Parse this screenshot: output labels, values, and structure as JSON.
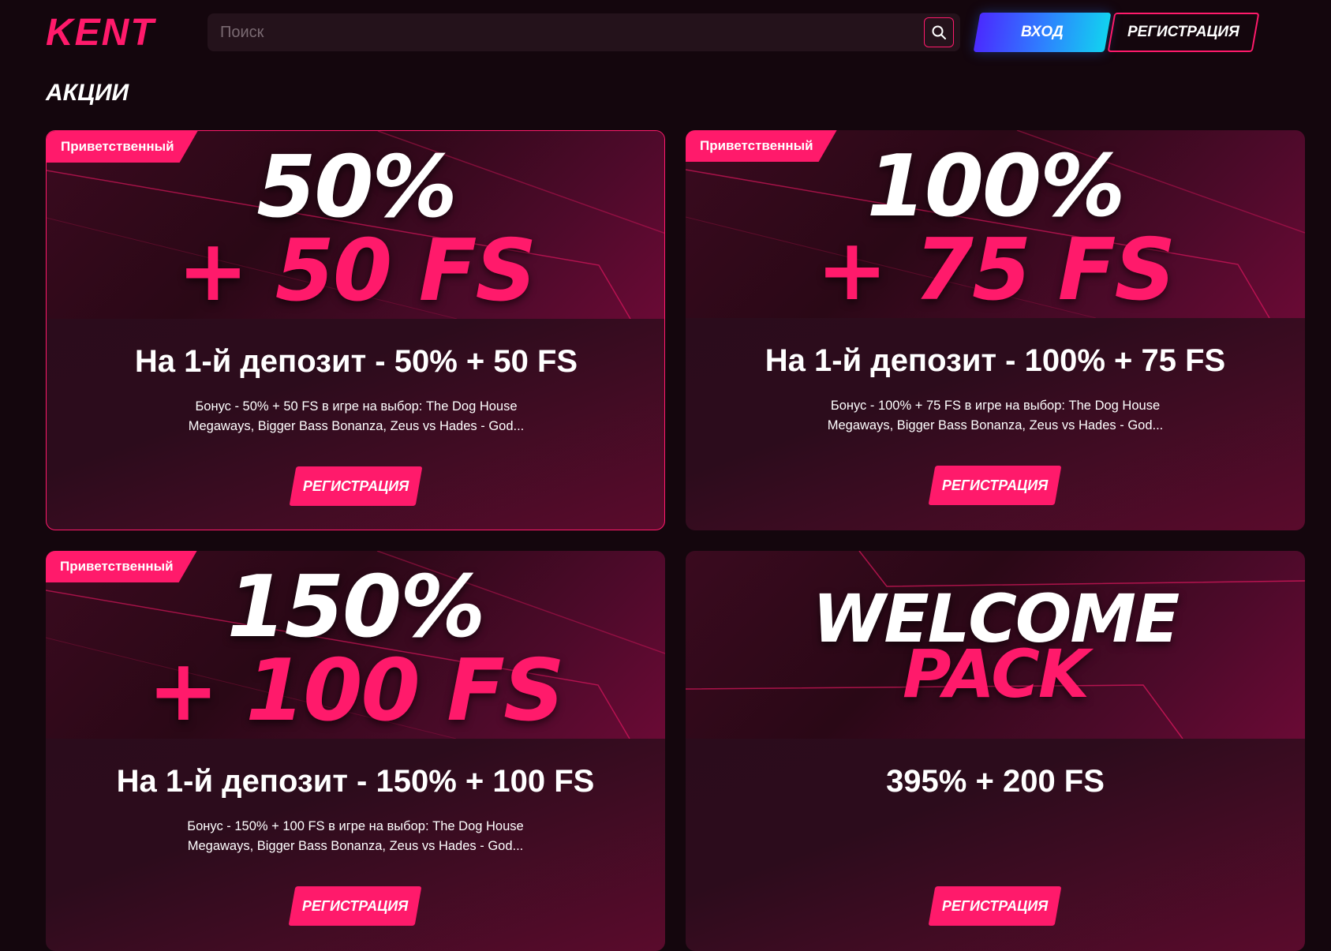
{
  "header": {
    "logo": "KENT",
    "search_placeholder": "Поиск",
    "login_label": "ВХОД",
    "register_label": "РЕГИСТРАЦИЯ"
  },
  "page": {
    "title": "АКЦИИ"
  },
  "cards": [
    {
      "tag": "Приветственный",
      "banner_line1": "50%",
      "banner_line2": "+ 50 FS",
      "title": "На 1-й депозит - 50% + 50 FS",
      "description": "Бонус - 50% + 50 FS в игре на выбор: The Dog House Megaways, Bigger Bass Bonanza, Zeus vs Hades - God...",
      "button": "РЕГИСТРАЦИЯ"
    },
    {
      "tag": "Приветственный",
      "banner_line1": "100%",
      "banner_line2": "+ 75 FS",
      "title": "На 1-й депозит - 100% + 75 FS",
      "description": "Бонус - 100% + 75 FS в игре на выбор: The Dog House Megaways, Bigger Bass Bonanza, Zeus vs Hades - God...",
      "button": "РЕГИСТРАЦИЯ"
    },
    {
      "tag": "Приветственный",
      "banner_line1": "150%",
      "banner_line2": "+ 100 FS",
      "title": "На 1-й депозит - 150% + 100 FS",
      "description": "Бонус - 150% + 100 FS в игре на выбор: The Dog House Megaways, Bigger Bass Bonanza, Zeus vs Hades - God...",
      "button": "РЕГИСТРАЦИЯ"
    },
    {
      "banner_line1": "WELCOME",
      "banner_line2": "PACK",
      "title": "395% + 200 FS",
      "button": "РЕГИСТРАЦИЯ"
    }
  ],
  "colors": {
    "accent": "#ff1a6b",
    "background": "#14060d",
    "login_gradient_start": "#4a2bff",
    "login_gradient_end": "#12d2f0"
  },
  "icons": {
    "search": "search-icon"
  }
}
